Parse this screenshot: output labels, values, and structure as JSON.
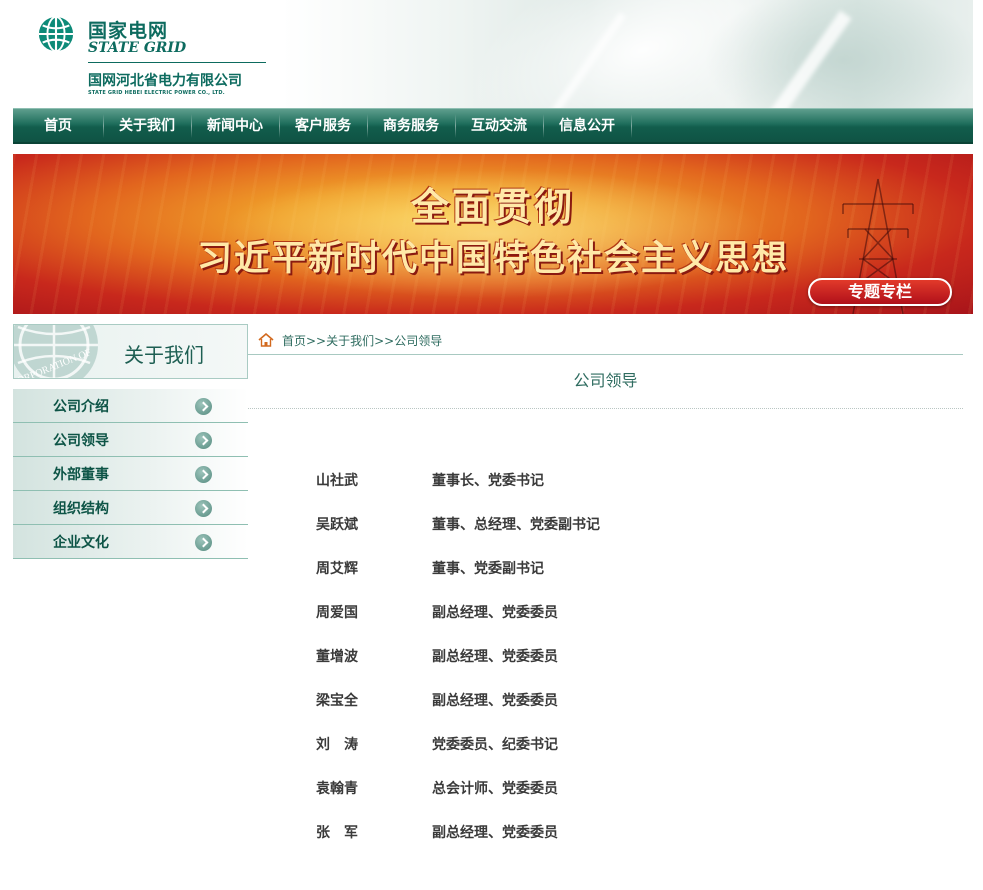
{
  "header": {
    "logo_cn": "国家电网",
    "logo_en": "STATE GRID",
    "company_cn": "国网河北省电力有限公司",
    "company_en": "STATE GRID HEBEI ELECTRIC POWER CO., LTD."
  },
  "nav": {
    "items": [
      {
        "label": "首页"
      },
      {
        "label": "关于我们"
      },
      {
        "label": "新闻中心"
      },
      {
        "label": "客户服务"
      },
      {
        "label": "商务服务"
      },
      {
        "label": "互动交流"
      },
      {
        "label": "信息公开"
      }
    ]
  },
  "banner": {
    "line1": "全面贯彻",
    "line2": "习近平新时代中国特色社会主义思想",
    "button": "专题专栏"
  },
  "sidebar": {
    "title": "关于我们",
    "globe_text": "CORPORATION OF",
    "items": [
      {
        "label": "公司介绍"
      },
      {
        "label": "公司领导"
      },
      {
        "label": "外部董事"
      },
      {
        "label": "组织结构"
      },
      {
        "label": "企业文化"
      }
    ]
  },
  "breadcrumb": {
    "text": "首页>>关于我们>>公司领导"
  },
  "page": {
    "title": "公司领导"
  },
  "leaders": [
    {
      "name": "山社武",
      "role": "董事长、党委书记"
    },
    {
      "name": "吴跃斌",
      "role": "董事、总经理、党委副书记"
    },
    {
      "name": "周艾辉",
      "role": "董事、党委副书记"
    },
    {
      "name": "周爱国",
      "role": "副总经理、党委委员"
    },
    {
      "name": "董增波",
      "role": "副总经理、党委委员"
    },
    {
      "name": "梁宝全",
      "role": "副总经理、党委委员"
    },
    {
      "name": "刘　涛",
      "role": "党委委员、纪委书记"
    },
    {
      "name": "袁翰青",
      "role": "总会计师、党委委员"
    },
    {
      "name": "张　军",
      "role": "副总经理、党委委员"
    }
  ],
  "colors": {
    "brand_green": "#0d6b5f",
    "nav_dark": "#125d4c",
    "banner_red": "#c8281c",
    "banner_gold": "#ffe9a8"
  }
}
